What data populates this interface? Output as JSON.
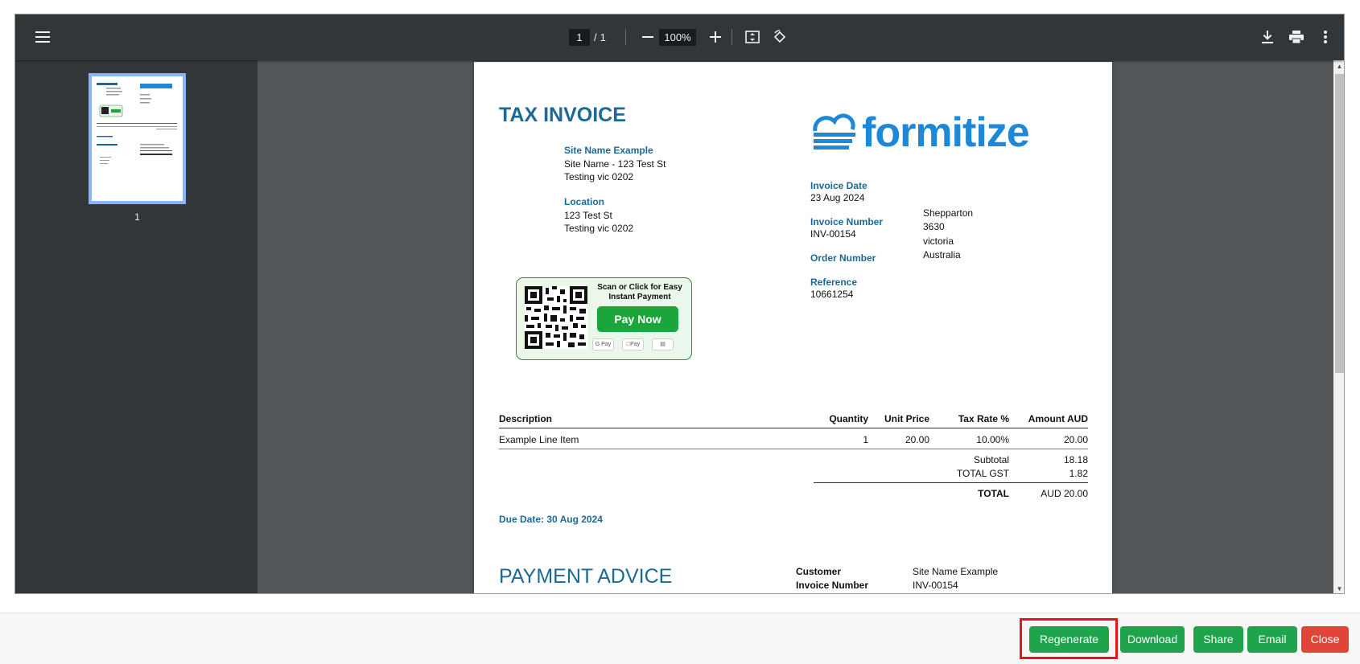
{
  "viewer": {
    "page_current": "1",
    "page_total": "1",
    "zoom": "100%",
    "thumbnail_label": "1"
  },
  "invoice": {
    "title": "TAX INVOICE",
    "logo_text": "formitize",
    "site_label": "Site Name Example",
    "site_line1": "Site Name - 123 Test St",
    "site_line2": "Testing vic 0202",
    "location_label": "Location",
    "location_line1": "123 Test St",
    "location_line2": "Testing vic 0202",
    "invoice_date_label": "Invoice Date",
    "invoice_date": "23 Aug 2024",
    "invoice_number_label": "Invoice Number",
    "invoice_number": "INV-00154",
    "order_number_label": "Order Number",
    "reference_label": "Reference",
    "reference": "10661254",
    "address_line1": "Shepparton",
    "address_line2": "3630",
    "address_line3": "victoria",
    "address_line4": "Australia",
    "pay_caption": "Scan or Click for Easy Instant Payment",
    "pay_button": "Pay Now",
    "pay_chips": [
      "G Pay",
      "Pay",
      "▤"
    ],
    "table": {
      "headers": [
        "Description",
        "Quantity",
        "Unit Price",
        "Tax Rate %",
        "Amount AUD"
      ],
      "rows": [
        [
          "Example Line Item",
          "1",
          "20.00",
          "10.00%",
          "20.00"
        ]
      ],
      "subtotal_label": "Subtotal",
      "subtotal": "18.18",
      "gst_label": "TOTAL GST",
      "gst": "1.82",
      "total_label": "TOTAL",
      "total": "AUD 20.00"
    },
    "due_date": "Due Date: 30 Aug 2024",
    "payment_advice_title": "PAYMENT ADVICE",
    "pa_customer_label": "Customer",
    "pa_customer": "Site Name Example",
    "pa_invoice_label": "Invoice Number",
    "pa_invoice": "INV-00154"
  },
  "actions": {
    "regenerate": "Regenerate",
    "download": "Download",
    "share": "Share",
    "email": "Email",
    "close": "Close"
  },
  "colors": {
    "toolbar": "#323639",
    "invoice_blue": "#1b6a96",
    "logo_blue": "#1e88d6",
    "button_green": "#1fa34d",
    "button_red": "#e0453a",
    "highlight_red": "#e8141c"
  }
}
